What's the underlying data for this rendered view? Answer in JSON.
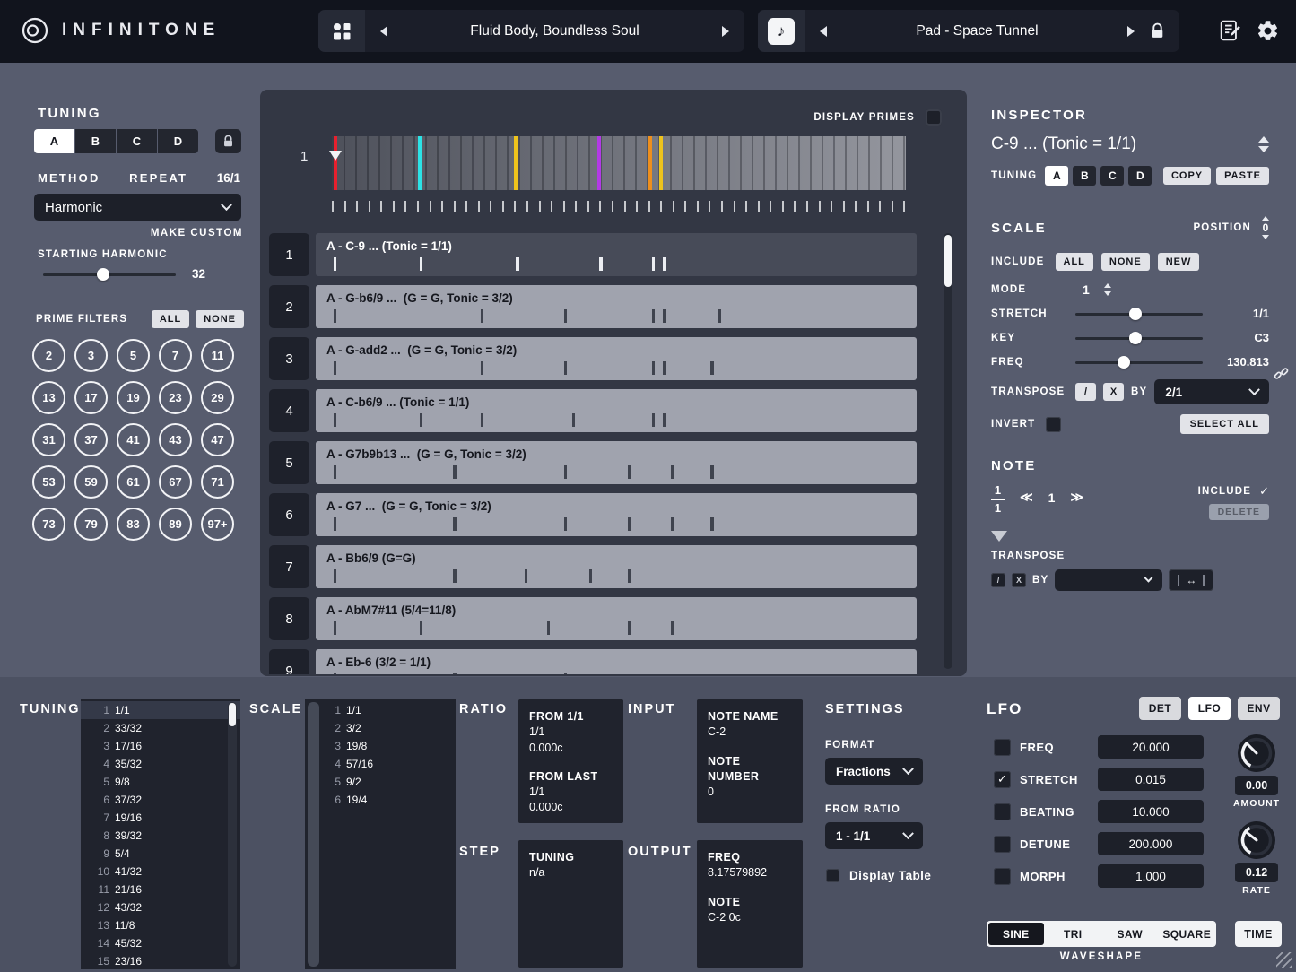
{
  "colors": {
    "background": "#575c6e",
    "topbar": "#11141d",
    "panel_dark": "#333744",
    "box_dark": "#1d2029",
    "row_light": "#a0a3ae",
    "row_selected": "#474b58"
  },
  "header": {
    "logo_text": "INFINITONE",
    "preset_name": "Fluid Body, Boundless Soul",
    "patch_name": "Pad - Space Tunnel"
  },
  "tuning_panel": {
    "title": "TUNING",
    "slots": [
      "A",
      "B",
      "C",
      "D"
    ],
    "method_label": "METHOD",
    "repeat_label": "REPEAT",
    "repeat_value": "16/1",
    "method_value": "Harmonic",
    "make_custom_label": "MAKE CUSTOM",
    "starting_harmonic_label": "STARTING HARMONIC",
    "starting_harmonic_value": "32",
    "prime_filters_label": "PRIME FILTERS",
    "all_label": "ALL",
    "none_label": "NONE",
    "primes": [
      "2",
      "3",
      "5",
      "7",
      "11",
      "13",
      "17",
      "19",
      "23",
      "29",
      "31",
      "37",
      "41",
      "43",
      "47",
      "53",
      "59",
      "61",
      "67",
      "71",
      "73",
      "79",
      "83",
      "89",
      "97+"
    ]
  },
  "scale_view": {
    "display_primes_label": "DISPLAY PRIMES",
    "strip_row_number": "1",
    "ruler_tick_count": 48,
    "markers": [
      {
        "color": "#e8202e",
        "pos": 0.6,
        "pointer": true
      },
      {
        "color": "#2ce2e6",
        "pos": 15.3
      },
      {
        "color": "#eec31d",
        "pos": 32.0
      },
      {
        "color": "#b33ae6",
        "pos": 46.6
      },
      {
        "color": "#ee8f1d",
        "pos": 55.5
      },
      {
        "color": "#eec31d",
        "pos": 57.3
      }
    ],
    "rows": [
      {
        "num": "1",
        "label": "A - C-9 ... (Tonic = 1/1)",
        "selected": true,
        "ticks": [
          1.8,
          16.5,
          32.9,
          47.1,
          56.1,
          58.0
        ]
      },
      {
        "num": "2",
        "label": "A - G-b6/9 ...  (G = G, Tonic = 3/2)",
        "selected": false,
        "ticks": [
          1.8,
          26.9,
          41.1,
          56.1,
          58.0,
          67.3
        ]
      },
      {
        "num": "3",
        "label": "A - G-add2 ...  (G = G, Tonic = 3/2)",
        "selected": false,
        "ticks": [
          1.8,
          26.9,
          41.1,
          56.1,
          58.0,
          66.1
        ]
      },
      {
        "num": "4",
        "label": "A - C-b6/9 ... (Tonic = 1/1)",
        "selected": false,
        "ticks": [
          1.8,
          16.5,
          26.9,
          42.5,
          56.1,
          58.0
        ]
      },
      {
        "num": "5",
        "label": "A - G7b9b13 ...  (G = G, Tonic = 3/2)",
        "selected": false,
        "ticks": [
          1.8,
          22.2,
          41.1,
          52.0,
          59.3,
          66.1
        ]
      },
      {
        "num": "6",
        "label": "A - G7 ...  (G = G, Tonic = 3/2)",
        "selected": false,
        "ticks": [
          1.8,
          22.2,
          41.1,
          52.0,
          59.3,
          66.1
        ]
      },
      {
        "num": "7",
        "label": "A - Bb6/9 (G=G)",
        "selected": false,
        "ticks": [
          1.8,
          22.2,
          34.4,
          45.4,
          52.0
        ]
      },
      {
        "num": "8",
        "label": "A - AbM7#11 (5/4=11/8)",
        "selected": false,
        "ticks": [
          1.8,
          16.5,
          38.2,
          52.0,
          59.3
        ]
      },
      {
        "num": "9",
        "label": "A - Eb-6 (3/2 = 1/1)",
        "selected": false,
        "ticks": [
          1.8,
          22.2,
          41.1
        ]
      }
    ]
  },
  "inspector": {
    "title": "INSPECTOR",
    "chord_title": "C-9 ... (Tonic = 1/1)",
    "tuning_label": "TUNING",
    "copy_label": "COPY",
    "paste_label": "PASTE",
    "scale_label": "SCALE",
    "position_label": "POSITION",
    "position_value": "0",
    "include_label": "INCLUDE",
    "all_label": "ALL",
    "none_label": "NONE",
    "new_label": "NEW",
    "mode_label": "MODE",
    "mode_value": "1",
    "stretch_label": "STRETCH",
    "stretch_value": "1/1",
    "key_label": "KEY",
    "key_value": "C3",
    "freq_label": "FREQ",
    "freq_value": "130.813",
    "transpose_label": "TRANSPOSE",
    "divide_label": "/",
    "multiply_label": "X",
    "by_label": "BY",
    "transpose_ratio": "2/1",
    "invert_label": "INVERT",
    "select_all_label": "SELECT ALL",
    "note_label": "NOTE",
    "note_fraction_num": "1",
    "note_fraction_den": "1",
    "prev_label": "≪",
    "next_label": "≫",
    "note_index": "1",
    "note_include_label": "INCLUDE",
    "check_glyph": "✓",
    "delete_label": "DELETE",
    "note_transpose_label": "TRANSPOSE"
  },
  "bottom": {
    "tuning_label": "TUNING",
    "tuning_list": [
      {
        "n": "1",
        "v": "1/1"
      },
      {
        "n": "2",
        "v": "33/32"
      },
      {
        "n": "3",
        "v": "17/16"
      },
      {
        "n": "4",
        "v": "35/32"
      },
      {
        "n": "5",
        "v": "9/8"
      },
      {
        "n": "6",
        "v": "37/32"
      },
      {
        "n": "7",
        "v": "19/16"
      },
      {
        "n": "8",
        "v": "39/32"
      },
      {
        "n": "9",
        "v": "5/4"
      },
      {
        "n": "10",
        "v": "41/32"
      },
      {
        "n": "11",
        "v": "21/16"
      },
      {
        "n": "12",
        "v": "43/32"
      },
      {
        "n": "13",
        "v": "11/8"
      },
      {
        "n": "14",
        "v": "45/32"
      },
      {
        "n": "15",
        "v": "23/16"
      }
    ],
    "scale_label": "SCALE",
    "scale_list": [
      {
        "n": "1",
        "v": "1/1"
      },
      {
        "n": "2",
        "v": "3/2"
      },
      {
        "n": "3",
        "v": "19/8"
      },
      {
        "n": "4",
        "v": "57/16"
      },
      {
        "n": "5",
        "v": "9/2"
      },
      {
        "n": "6",
        "v": "19/4"
      }
    ],
    "ratio_label": "RATIO",
    "ratio": {
      "from_first_label": "FROM 1/1",
      "from_first_value": "1/1",
      "from_first_cents": "0.000c",
      "from_last_label": "FROM LAST",
      "from_last_value": "1/1",
      "from_last_cents": "0.000c"
    },
    "step_label": "STEP",
    "step": {
      "tuning_label": "TUNING",
      "tuning_value": "n/a"
    },
    "input_label": "INPUT",
    "input": {
      "note_name_label": "NOTE NAME",
      "note_name_value": "C-2",
      "note_number_label": "NOTE NUMBER",
      "note_number_value": "0"
    },
    "output_label": "OUTPUT",
    "output": {
      "freq_label": "FREQ",
      "freq_value": "8.17579892",
      "note_label": "NOTE",
      "note_value": "C-2 0c"
    },
    "settings": {
      "title": "SETTINGS",
      "format_label": "FORMAT",
      "format_value": "Fractions",
      "from_ratio_label": "FROM RATIO",
      "from_ratio_value": "1 - 1/1",
      "display_table_label": "Display Table"
    },
    "lfo": {
      "title": "LFO",
      "tabs": [
        "DET",
        "LFO",
        "ENV"
      ],
      "active_tab": "LFO",
      "check_glyph": "✓",
      "params": [
        {
          "label": "FREQ",
          "value": "20.000",
          "checked": false
        },
        {
          "label": "STRETCH",
          "value": "0.015",
          "checked": true
        },
        {
          "label": "BEATING",
          "value": "10.000",
          "checked": false
        },
        {
          "label": "DETUNE",
          "value": "200.000",
          "checked": false
        },
        {
          "label": "MORPH",
          "value": "1.000",
          "checked": false
        }
      ],
      "amount_value": "0.00",
      "amount_label": "AMOUNT",
      "rate_value": "0.12",
      "rate_label": "RATE",
      "waveshapes": [
        "SINE",
        "TRI",
        "SAW",
        "SQUARE"
      ],
      "active_waveshape": "SINE",
      "time_label": "TIME",
      "waveshape_label": "WAVESHAPE"
    }
  }
}
